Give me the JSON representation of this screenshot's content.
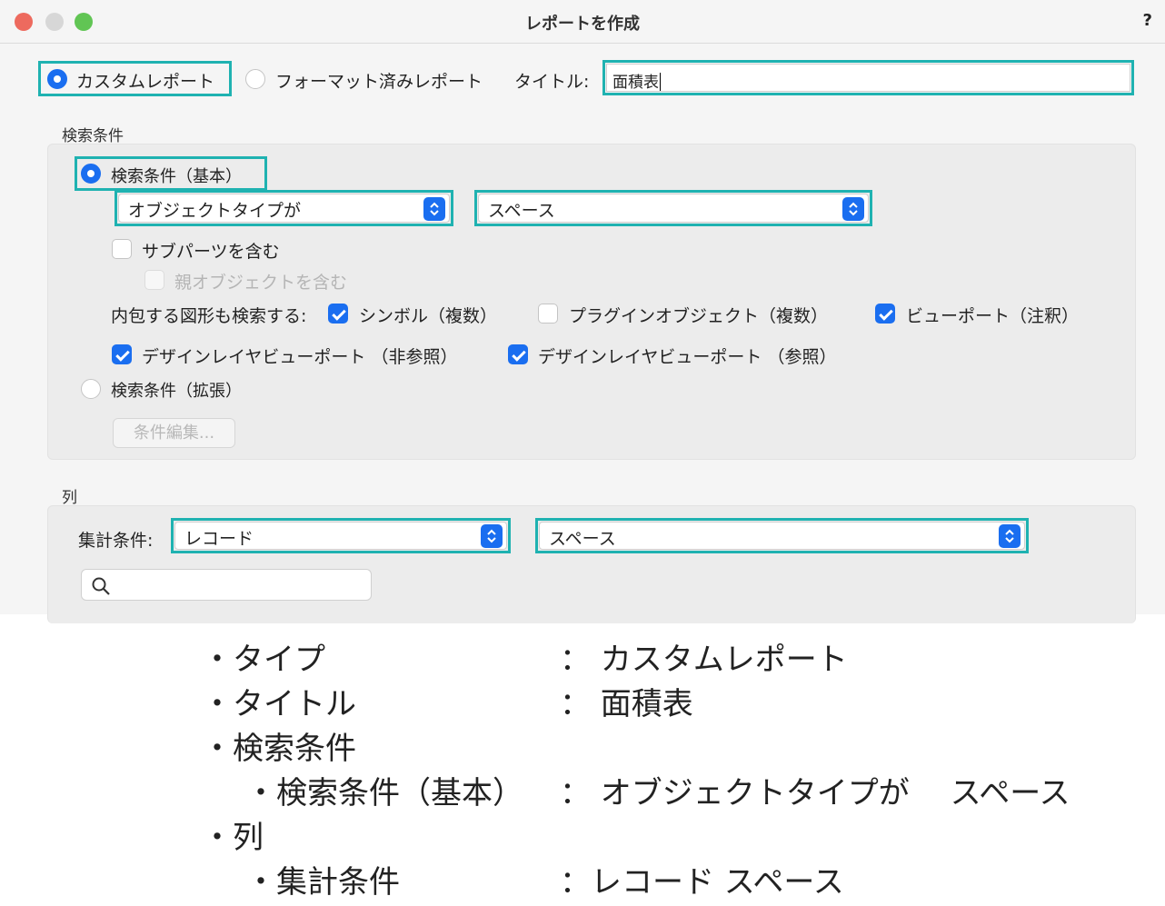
{
  "window": {
    "title": "レポートを作成",
    "help": "?"
  },
  "report_type": {
    "custom": "カスタムレポート",
    "formatted": "フォーマット済みレポート",
    "title_label": "タイトル:",
    "title_value": "面積表"
  },
  "search": {
    "section_label": "検索条件",
    "basic_label": "検索条件（基本）",
    "object_type": "オブジェクトタイプが",
    "object_value": "スペース",
    "include_subparts": "サブパーツを含む",
    "include_parent": "親オブジェクトを含む",
    "include_shapes_label": "内包する図形も検索する:",
    "symbols": "シンボル（複数）",
    "plugin_objects": "プラグインオブジェクト（複数）",
    "viewports": "ビューポート（注釈）",
    "dl_viewport_nonref": "デザインレイヤビューポート （非参照）",
    "dl_viewport_ref": "デザインレイヤビューポート （参照）",
    "advanced_label": "検索条件（拡張）",
    "edit_conditions": "条件編集..."
  },
  "columns": {
    "section_label": "列",
    "aggregate_label": "集計条件:",
    "aggregate_value": "レコード",
    "aggregate_value2": "スペース",
    "search_placeholder": ""
  },
  "summary": {
    "type_label": "・タイプ",
    "type_value": "： カスタムレポート",
    "title_label": "・タイトル",
    "title_value": "： 面積表",
    "search_label": "・検索条件",
    "search_basic_label": "・検索条件（基本）",
    "search_basic_value": "： オブジェクトタイプが　 スペース",
    "columns_label": "・列",
    "aggregate_label": "・集計条件",
    "aggregate_value": "：レコード  スペース"
  },
  "colors": {
    "accent": "#1a6ef0",
    "highlight": "#1fb2b1"
  }
}
